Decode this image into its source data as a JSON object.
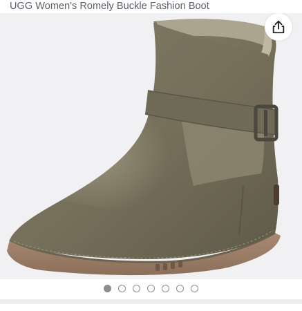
{
  "product": {
    "title": "UGG Women's Romely Buckle Fashion Boot"
  },
  "gallery": {
    "image_alt": "Olive leather ankle boot with buckle strap and shearling lining",
    "share_icon": "share-icon",
    "dot_count": 7,
    "active_index": 0
  },
  "colors": {
    "boot_leather": "#7a7560",
    "shearling": "#aaa48e",
    "sole": "#9a7c66",
    "gallery_bg": "#f1f0f2",
    "dot": "#8a8d91"
  }
}
